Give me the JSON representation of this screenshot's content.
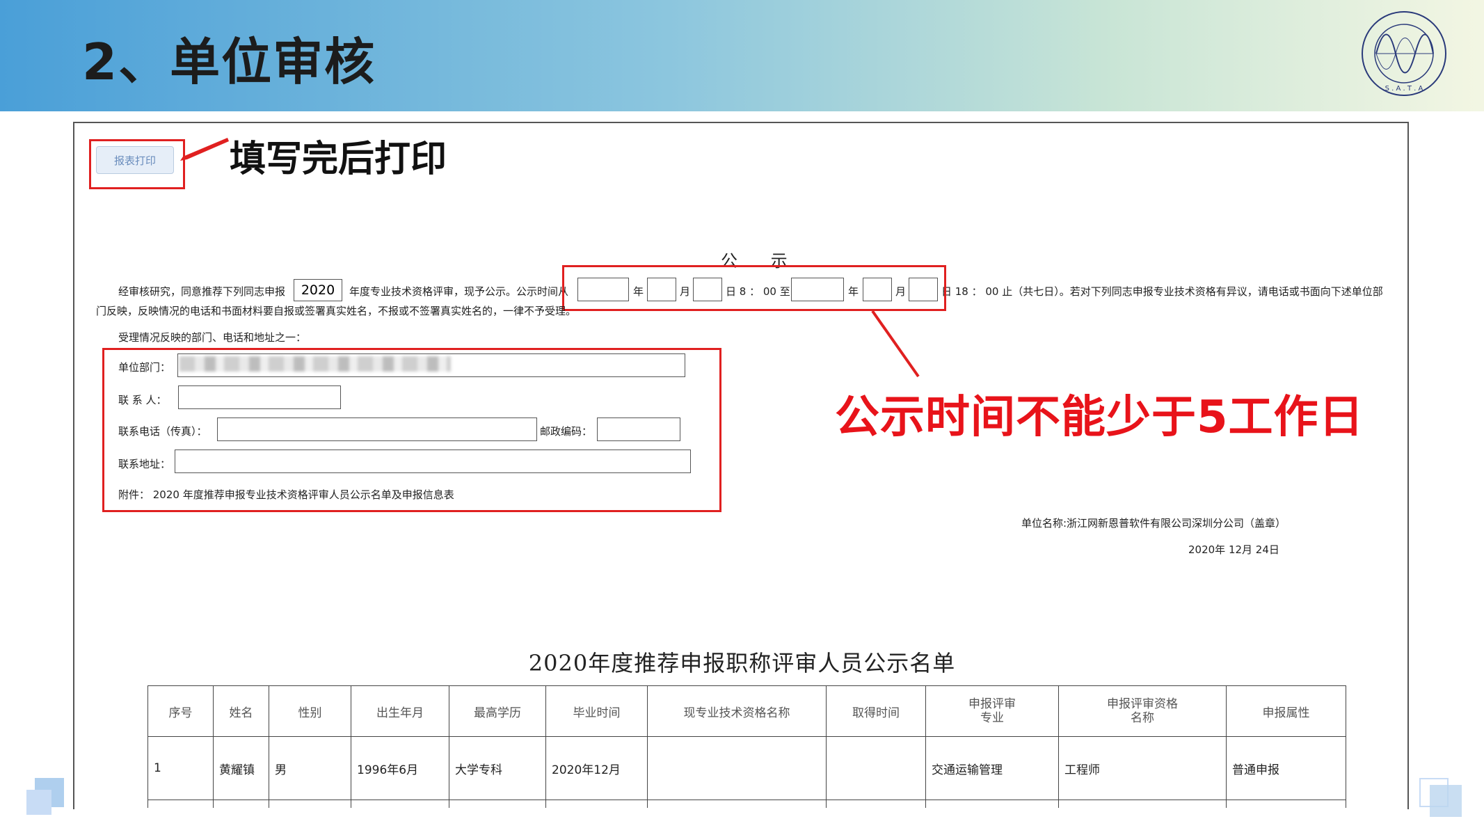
{
  "slide": {
    "title": "2、单位审核"
  },
  "logo": {
    "text": "SHENZHEN ASSOCIATION OF TESTERS AND ANALYSIS",
    "abbr": "S . A . T . A"
  },
  "toolbar": {
    "print_label": "报表打印"
  },
  "annotations": {
    "fill_then_print": "填写完后打印",
    "min_days": "公示时间不能少于5工作日"
  },
  "notice": {
    "title": "公 示",
    "intro": "经审核研究，同意推荐下列同志申报",
    "year_value": "2020",
    "mid": "年度专业技术资格评审，现予公示。公示时间从",
    "year_unit": "年",
    "month_unit": "月",
    "start_time": "日 8 ： 00 至",
    "end_time": "日 18 ： 00 止（共七日）。若对下列同志申报专业技术资格有异议，请电话或书面向下述单位部",
    "line2": "门反映，反映情况的电话和书面材料要自报或签署真实姓名，不报或不签署真实姓名的，一律不予受理。",
    "line3": "受理情况反映的部门、电话和地址之一："
  },
  "form": {
    "dept_label": "单位部门：",
    "contact_label": "联  系  人：",
    "phone_label": "联系电话（传真）：",
    "zip_label": "邮政编码：",
    "address_label": "联系地址：",
    "attachment": "附件：  2020 年度推荐申报专业技术资格评审人员公示名单及申报信息表"
  },
  "signature": {
    "org": "单位名称:浙江网新恩普软件有限公司深圳分公司（盖章）",
    "date": "2020年    12月    24日"
  },
  "table": {
    "title": "2020年度推荐申报职称评审人员公示名单",
    "headers": [
      "序号",
      "姓名",
      "性别",
      "出生年月",
      "最高学历",
      "毕业时间",
      "现专业技术资格名称",
      "取得时间",
      "申报评审\n专业",
      "申报评审资格\n名称",
      "申报属性"
    ],
    "rows": [
      [
        "1",
        "黄耀镇",
        "男",
        "1996年6月",
        "大学专科",
        "2020年12月",
        "",
        "",
        "交通运输管理",
        "工程师",
        "普通申报"
      ]
    ]
  }
}
